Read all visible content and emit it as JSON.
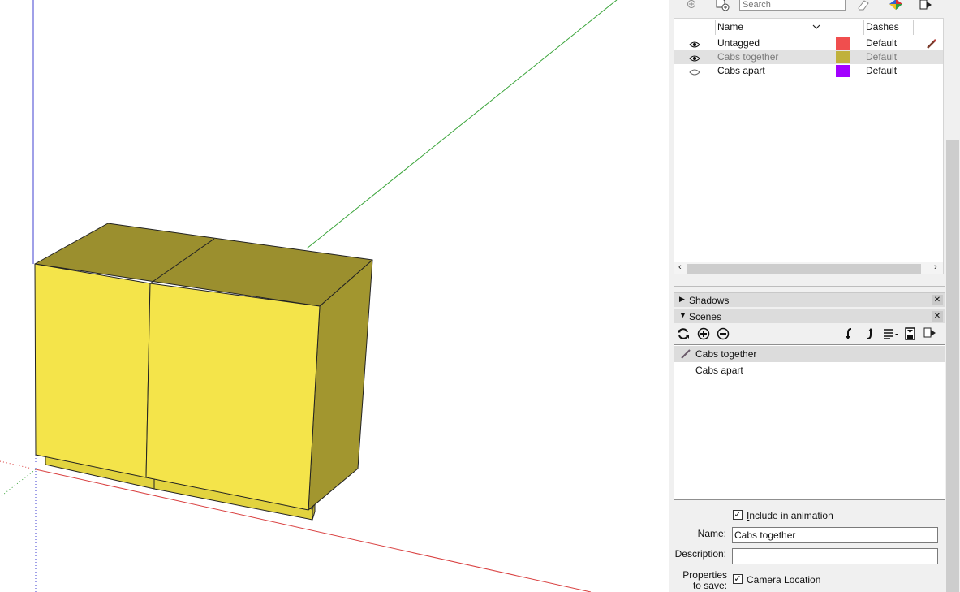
{
  "tags_panel": {
    "search_placeholder": "Search",
    "columns": {
      "name": "Name",
      "dashes": "Dashes"
    },
    "rows": [
      {
        "name": "Untagged",
        "visible": true,
        "color": "#f04e4e",
        "dashes": "Default",
        "current": true,
        "selected": false
      },
      {
        "name": "Cabs together",
        "visible": true,
        "color": "#c0b13c",
        "dashes": "Default",
        "current": false,
        "selected": true
      },
      {
        "name": "Cabs apart",
        "visible": false,
        "color": "#a200ff",
        "dashes": "Default",
        "current": false,
        "selected": false
      }
    ]
  },
  "panels": {
    "shadows": {
      "title": "Shadows"
    },
    "scenes": {
      "title": "Scenes"
    }
  },
  "scenes": {
    "list": [
      {
        "name": "Cabs together",
        "active": true
      },
      {
        "name": "Cabs apart",
        "active": false
      }
    ],
    "include_in_animation": {
      "label": "Include in animation",
      "checked": true
    },
    "name_label": "Name:",
    "name_value": "Cabs together",
    "description_label": "Description:",
    "description_value": "",
    "properties_label_1": "Properties",
    "properties_label_2": "to save:",
    "camera_location": {
      "label": "Camera Location",
      "checked": true
    }
  },
  "colors": {
    "cab_front": "#f4e44a",
    "cab_top": "#9b8f2e",
    "cab_side": "#a2962f",
    "axis_red": "#d94040",
    "axis_green": "#3aa43a",
    "axis_blue": "#4040d0"
  }
}
